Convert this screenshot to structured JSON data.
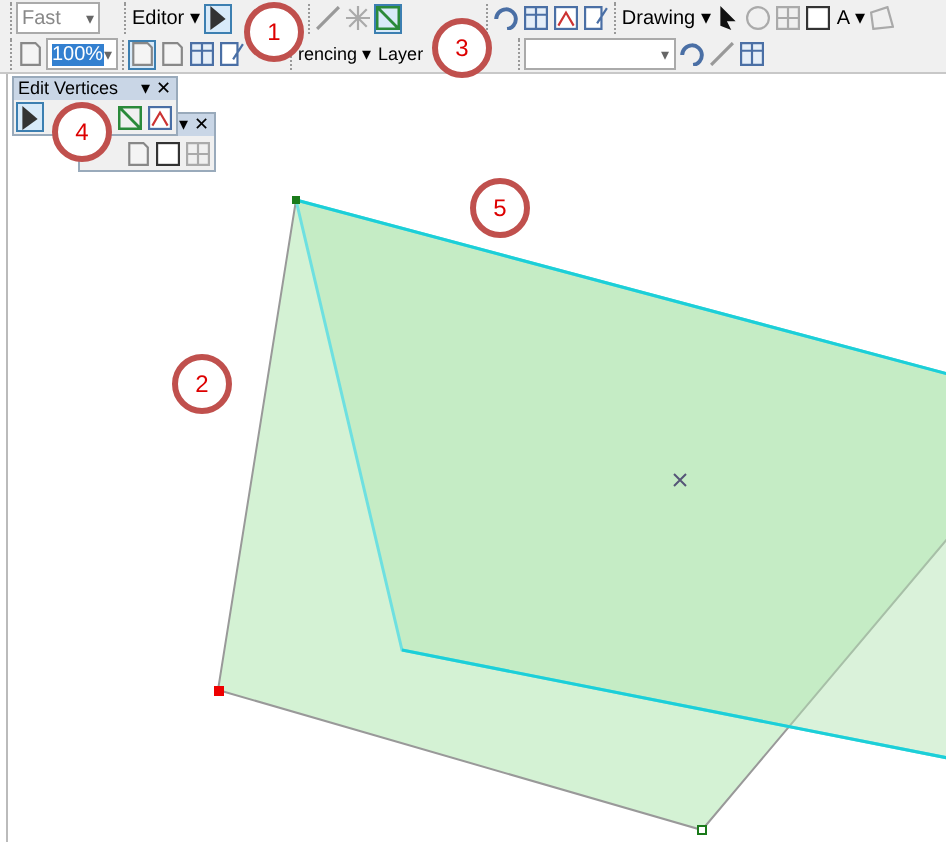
{
  "toolbar_rows": [
    {
      "groups": [
        [
          {
            "kind": "combo",
            "text": "Fast",
            "caret": "▾"
          }
        ],
        [
          {
            "kind": "menu",
            "text": "Editor",
            "caret": "▾"
          },
          {
            "kind": "icon",
            "selected": true
          }
        ],
        [
          {
            "kind": "icon",
            "selected": false
          },
          {
            "kind": "icon",
            "selected": false
          },
          {
            "kind": "icon",
            "selected": true
          }
        ],
        [
          {
            "kind": "icon",
            "selected": false
          },
          {
            "kind": "icon",
            "selected": false
          },
          {
            "kind": "icon",
            "selected": false
          },
          {
            "kind": "icon",
            "selected": false
          }
        ],
        [
          {
            "kind": "menu",
            "text": "Drawing",
            "caret": "▾"
          },
          {
            "kind": "icon",
            "selected": false
          },
          {
            "kind": "icon",
            "selected": false
          },
          {
            "kind": "icon",
            "selected": false
          },
          {
            "kind": "icon",
            "selected": false
          },
          {
            "kind": "menu",
            "text": "A",
            "caret": "▾"
          },
          {
            "kind": "icon",
            "selected": false
          }
        ]
      ]
    },
    {
      "groups": [
        [
          {
            "kind": "icon",
            "selected": false
          },
          {
            "kind": "combo",
            "text": "100%",
            "caret": "▾"
          }
        ],
        [
          {
            "kind": "icon",
            "selected": true
          },
          {
            "kind": "icon",
            "selected": false
          },
          {
            "kind": "icon",
            "selected": false
          },
          {
            "kind": "icon",
            "selected": false
          }
        ],
        [
          {
            "kind": "menu",
            "text": "rencing",
            "caret": "▾"
          },
          {
            "kind": "menu",
            "text": "Layer"
          }
        ],
        [
          {
            "kind": "combo",
            "caret": "▾"
          },
          {
            "kind": "icon",
            "selected": false
          },
          {
            "kind": "icon",
            "selected": false
          },
          {
            "kind": "icon",
            "selected": false
          }
        ]
      ]
    }
  ],
  "floating_toolbars": [
    {
      "menu": "▾",
      "close": "✕",
      "tools": [
        {
          "selected": false
        },
        {
          "selected": false
        },
        {
          "selected": false
        }
      ]
    },
    {
      "title": "Edit Vertices",
      "menu": "▾",
      "close": "✕",
      "tools": [
        {
          "selected": true
        },
        {
          "selected": false
        },
        {
          "selected": false
        }
      ]
    }
  ],
  "annotations": [
    "1",
    "2",
    "3",
    "4",
    "5"
  ]
}
